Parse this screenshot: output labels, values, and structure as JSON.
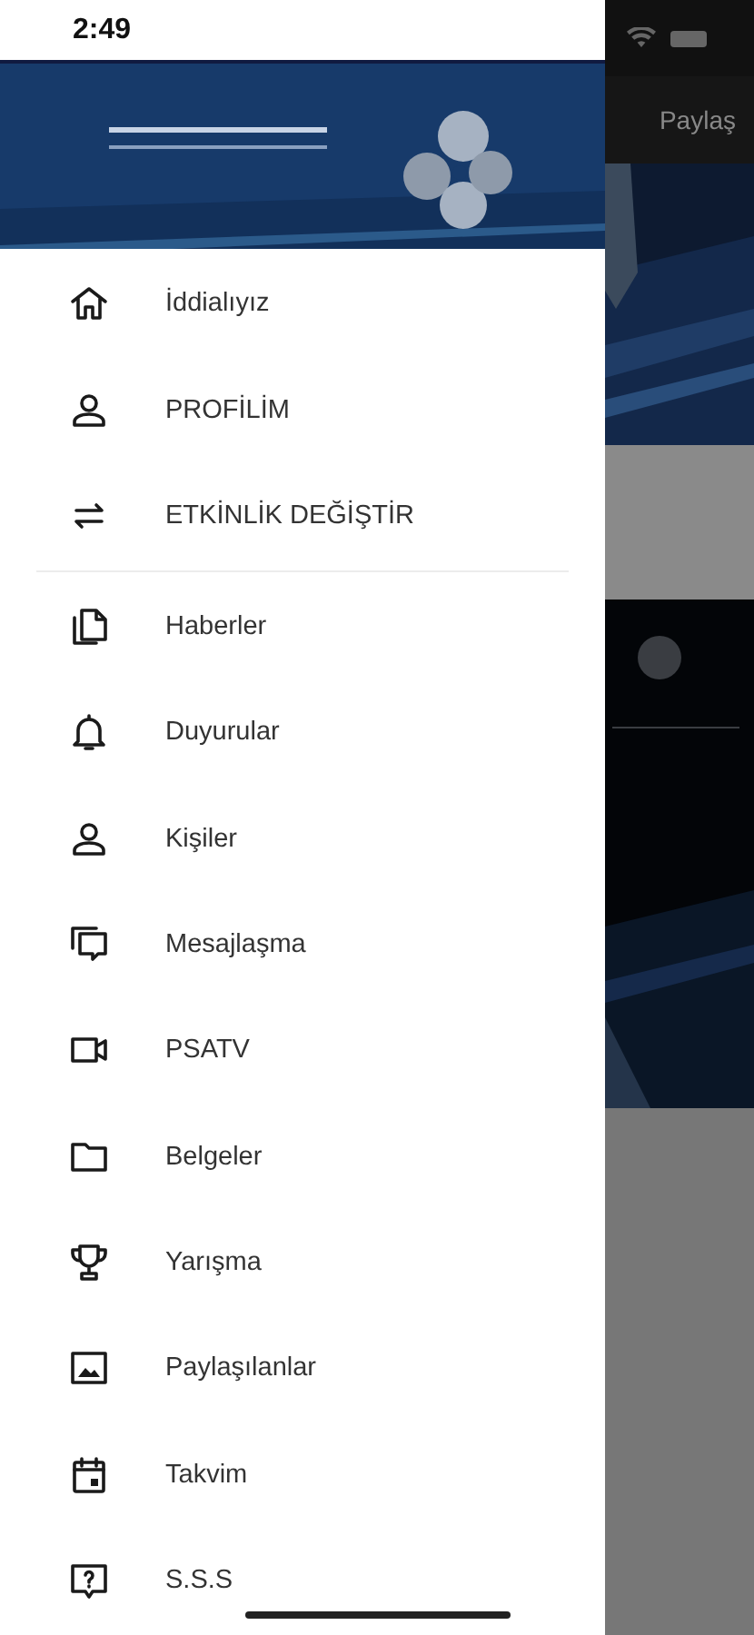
{
  "status_bar": {
    "time": "2:49"
  },
  "background_screen": {
    "header_action": "Paylaş"
  },
  "drawer": {
    "sections": [
      {
        "items": [
          {
            "label": "İddialıyız"
          },
          {
            "label": "PROFİLİM"
          },
          {
            "label": "ETKİNLİK DEĞİŞTİR"
          }
        ]
      },
      {
        "items": [
          {
            "label": "Haberler"
          },
          {
            "label": "Duyurular"
          },
          {
            "label": "Kişiler"
          },
          {
            "label": "Mesajlaşma"
          },
          {
            "label": "PSATV"
          },
          {
            "label": "Belgeler"
          },
          {
            "label": "Yarışma"
          },
          {
            "label": "Paylaşılanlar"
          },
          {
            "label": "Takvim"
          },
          {
            "label": "S.S.S"
          }
        ]
      }
    ]
  }
}
